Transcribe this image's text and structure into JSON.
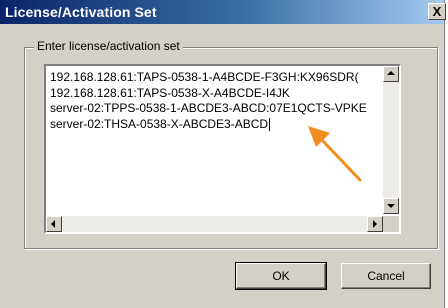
{
  "dialog": {
    "title": "License/Activation Set",
    "close_symbol": "X"
  },
  "group": {
    "legend": "Enter license/activation set"
  },
  "text_area": {
    "lines": [
      "192.168.128.61:TAPS-0538-1-A4BCDE-F3GH:KX96SDR(",
      "192.168.128.61:TAPS-0538-X-A4BCDE-I4JK",
      "server-02:TPPS-0538-1-ABCDE3-ABCD:07E1QCTS-VPKE",
      "server-02:THSA-0538-X-ABCDE3-ABCD"
    ]
  },
  "buttons": {
    "ok": "OK",
    "cancel": "Cancel"
  },
  "colors": {
    "title_start": "#0a246a",
    "title_end": "#a6caf0",
    "annotation_arrow": "#f28c1e"
  },
  "icons": {
    "close": "close-icon",
    "annotation": "orange-pointer-arrow"
  }
}
